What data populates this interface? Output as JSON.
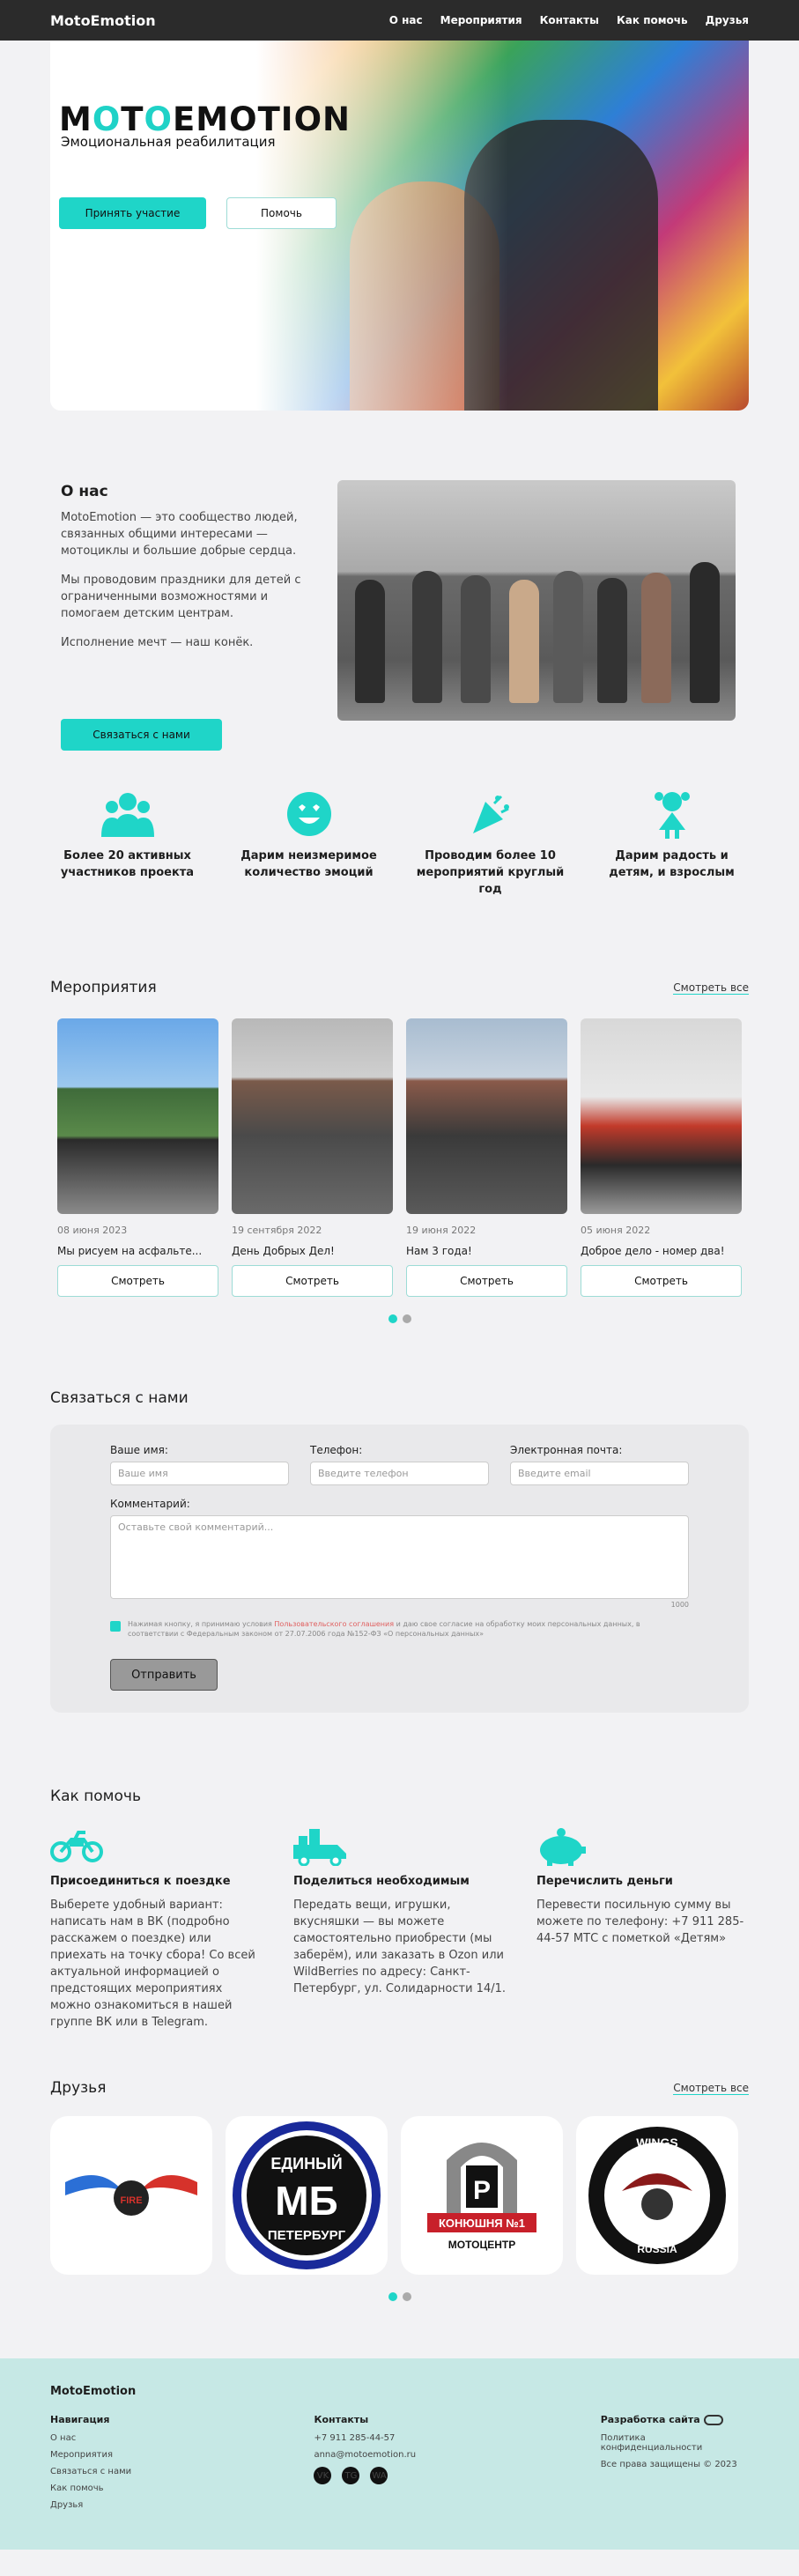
{
  "header": {
    "logo": "MotoEmotion",
    "nav": [
      "О нас",
      "Мероприятия",
      "Контакты",
      "Как помочь",
      "Друзья"
    ]
  },
  "hero": {
    "brand_pre": "M",
    "brand_o1": "O",
    "brand_mid": "T",
    "brand_o2": "O",
    "brand_post": "EMOTION",
    "subtitle": "Эмоциональная реабилитация",
    "primary_button": "Принять участие",
    "secondary_button": "Помочь"
  },
  "about": {
    "title": "О нас",
    "paragraphs": [
      "MotoEmotion — это сообщество людей, связанных общими интересами — мотоциклы и большие добрые сердца.",
      "Мы проводовим праздники для детей с ограниченными возможностями и помогаем детским центрам.",
      "Исполнение мечт — наш конёк."
    ],
    "button": "Связаться с нами"
  },
  "features": [
    {
      "icon": "people-icon",
      "text": "Более 20 активных участников проекта"
    },
    {
      "icon": "smile-hearts-icon",
      "text": "Дарим неизмеримое количество эмоций"
    },
    {
      "icon": "party-popper-icon",
      "text": "Проводим более 10 мероприятий круглый год"
    },
    {
      "icon": "girl-icon",
      "text": "Дарим радость и детям, и взрослым"
    }
  ],
  "events": {
    "title": "Мероприятия",
    "see_all": "Смотреть все",
    "items": [
      {
        "date": "08 июня 2023",
        "title": "Мы рисуем на асфальте...",
        "button": "Смотреть"
      },
      {
        "date": "19 сентября 2022",
        "title": "День Добрых Дел!",
        "button": "Смотреть"
      },
      {
        "date": "19 июня 2022",
        "title": "Нам 3 года!",
        "button": "Смотреть"
      },
      {
        "date": "05 июня 2022",
        "title": "Доброе дело - номер два!",
        "button": "Смотреть"
      }
    ]
  },
  "contact": {
    "title": "Связаться с нами",
    "name_label": "Ваше имя:",
    "name_placeholder": "Ваше имя",
    "phone_label": "Телефон:",
    "phone_placeholder": "Введите телефон",
    "email_label": "Электронная почта:",
    "email_placeholder": "Введите email",
    "comment_label": "Комментарий:",
    "comment_placeholder": "Оставьте свой комментарий...",
    "counter": "1000",
    "consent_pre": "Нажимая кнопку, я принимаю условия ",
    "consent_link": "Пользовательского соглашения",
    "consent_post": " и даю свое согласие на обработку моих персональных данных, в соответствии с Федеральным законом от 27.07.2006 года №152-ФЗ «О персональных данных»",
    "submit": "Отправить"
  },
  "help": {
    "title": "Как помочь",
    "items": [
      {
        "icon": "motorcycle-icon",
        "title": "Присоединиться к поездке",
        "text": "Выберете удобный вариант: написать нам в ВК (подробно расскажем о поездке) или приехать на точку сбора! Со всей актуальной информацией о предстоящих мероприятиях можно ознакомиться в нашей группе ВК или в Telegram."
      },
      {
        "icon": "delivery-truck-icon",
        "title": "Поделиться необходимым",
        "text": "Передать вещи, игрушки, вкусняшки — вы можете самостоятельно приобрести (мы заберём), или заказать в Ozon или WildBerries по адресу: Санкт-Петербург, ул. Солидарности 14/1."
      },
      {
        "icon": "piggy-bank-icon",
        "title": "Перечислить деньги",
        "text": "Перевести посильную сумму вы можете по телефону: +7 911 285-44-57 МТС с пометкой «Детям»"
      }
    ]
  },
  "friends": {
    "title": "Друзья",
    "see_all": "Смотреть все",
    "logos": [
      {
        "name": "wings-fire-logo",
        "line1": "FIRE",
        "line2": ""
      },
      {
        "name": "edinyi-mb-logo",
        "line1": "ЕДИНЫЙ",
        "line2": "МБ",
        "line3": "ПЕТЕРБУРГ"
      },
      {
        "name": "konyushnya-logo",
        "line1": "Р",
        "line2": "КОНЮШНЯ №1",
        "line3": "МОТОЦЕНТР"
      },
      {
        "name": "wings-russia-logo",
        "line1": "WINGS",
        "line2": "RUSSIA"
      }
    ]
  },
  "footer": {
    "brand": "MotoEmotion",
    "nav_title": "Навигация",
    "nav_items": [
      "О нас",
      "Мероприятия",
      "Связаться с нами",
      "Как помочь",
      "Друзья"
    ],
    "contacts_title": "Контакты",
    "phone": "+7 911 285-44-57",
    "email": "anna@motoemotion.ru",
    "socials": [
      "VK",
      "TG",
      "WA"
    ],
    "dev_title": "Разработка сайта",
    "policy": "Политика конфиденциальности",
    "rights": "Все права защищены © 2023"
  },
  "colors": {
    "accent": "#1fd5c8",
    "footer_bg": "#c6e8e5",
    "header_bg": "#2b2b2b"
  }
}
